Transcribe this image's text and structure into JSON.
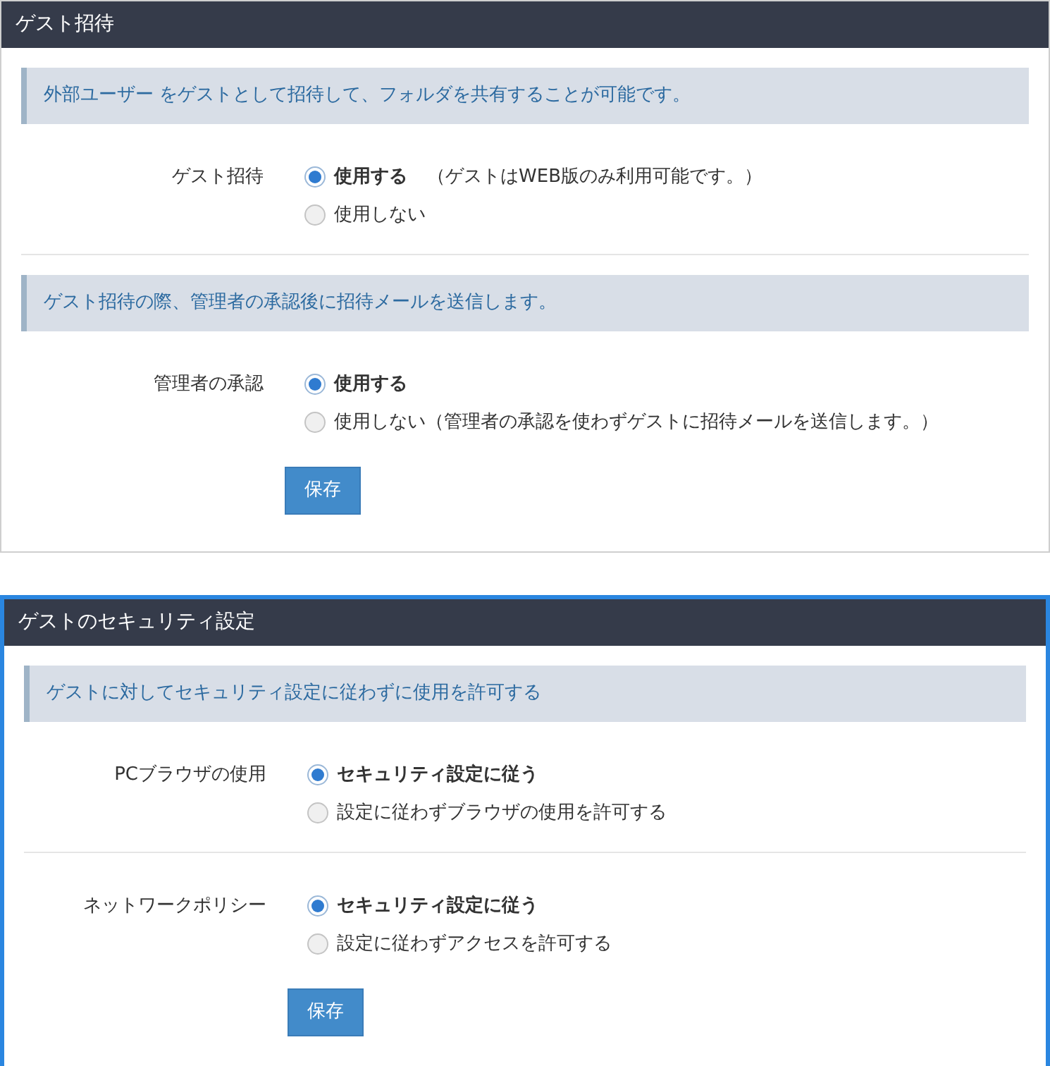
{
  "panels": [
    {
      "title": "ゲスト招待",
      "focused": false,
      "items": [
        {
          "kind": "notice",
          "text": "外部ユーザー をゲストとして招待して、フォルダを共有することが可能です。"
        },
        {
          "kind": "setting",
          "label": "ゲスト招待",
          "options": [
            {
              "label": "使用する",
              "note": "（ゲストはWEB版のみ利用可能です。）",
              "selected": true
            },
            {
              "label": "使用しない",
              "selected": false
            }
          ]
        },
        {
          "kind": "notice",
          "text": "ゲスト招待の際、管理者の承認後に招待メールを送信します。"
        },
        {
          "kind": "setting",
          "label": "管理者の承認",
          "options": [
            {
              "label": "使用する",
              "selected": true
            },
            {
              "label": "使用しない（管理者の承認を使わずゲストに招待メールを送信します。）",
              "selected": false
            }
          ]
        }
      ],
      "save": "保存"
    },
    {
      "title": "ゲストのセキュリティ設定",
      "focused": true,
      "items": [
        {
          "kind": "notice",
          "text": "ゲストに対してセキュリティ設定に従わずに使用を許可する"
        },
        {
          "kind": "setting",
          "label": "PCブラウザの使用",
          "options": [
            {
              "label": "セキュリティ設定に従う",
              "selected": true
            },
            {
              "label": "設定に従わずブラウザの使用を許可する",
              "selected": false
            }
          ]
        },
        {
          "kind": "setting",
          "label": "ネットワークポリシー",
          "options": [
            {
              "label": "セキュリティ設定に従う",
              "selected": true
            },
            {
              "label": "設定に従わずアクセスを許可する",
              "selected": false
            }
          ]
        }
      ],
      "save": "保存"
    }
  ]
}
